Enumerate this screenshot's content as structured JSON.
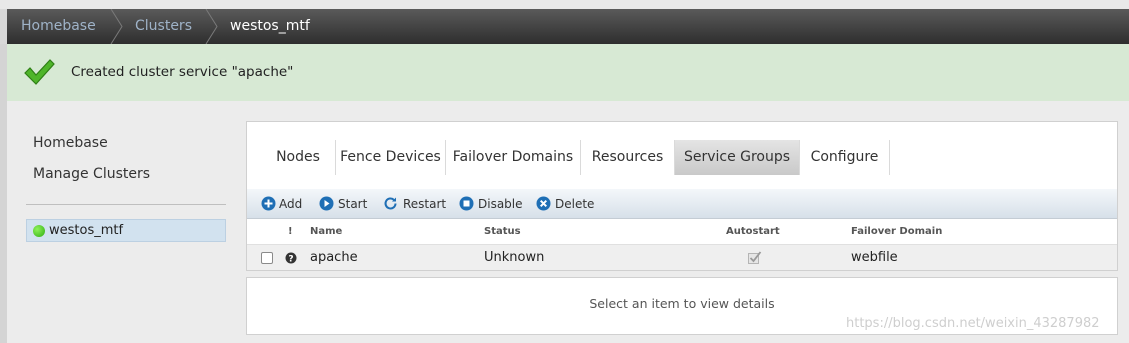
{
  "breadcrumb": {
    "items": [
      "Homebase",
      "Clusters"
    ],
    "current": "westos_mtf"
  },
  "notification": {
    "message": "Created cluster service \"apache\""
  },
  "sidebar": {
    "links": [
      "Homebase",
      "Manage Clusters"
    ],
    "cluster": {
      "name": "westos_mtf",
      "status_color": "#3cc21a"
    }
  },
  "tabs": [
    "Nodes",
    "Fence Devices",
    "Failover Domains",
    "Resources",
    "Service Groups",
    "Configure"
  ],
  "active_tab": "Service Groups",
  "toolbar": {
    "add": "Add",
    "start": "Start",
    "restart": "Restart",
    "disable": "Disable",
    "delete": "Delete"
  },
  "table": {
    "headers": {
      "flag": "!",
      "name": "Name",
      "status": "Status",
      "autostart": "Autostart",
      "domain": "Failover Domain"
    },
    "rows": [
      {
        "name": "apache",
        "status": "Unknown",
        "autostart": true,
        "domain": "webfile"
      }
    ]
  },
  "details": {
    "placeholder": "Select an item to view details"
  },
  "watermark": "https://blog.csdn.net/weixin_43287982",
  "colors": {
    "accent_blue": "#1f6fb5",
    "notice_bg": "#d7e9d4",
    "success_green": "#3cc21a"
  }
}
